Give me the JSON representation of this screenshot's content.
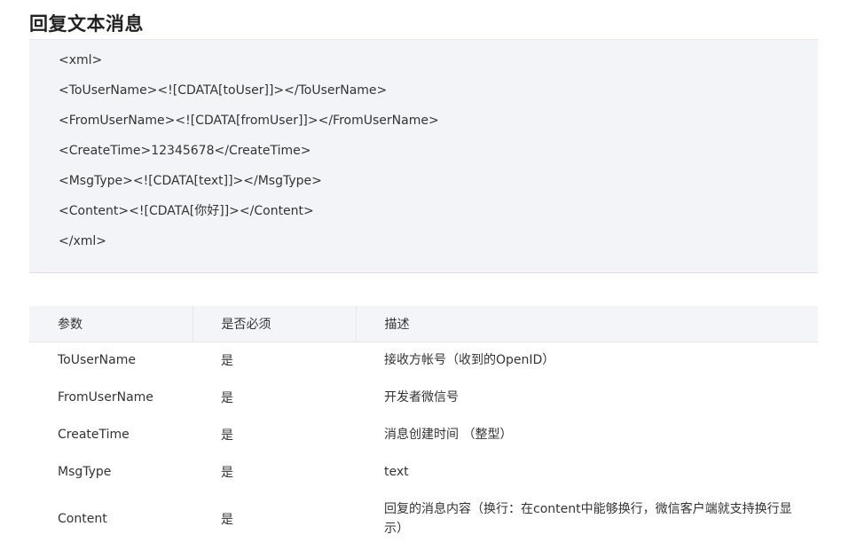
{
  "section": {
    "title": "回复文本消息"
  },
  "code": {
    "lines": [
      "<xml>",
      "<ToUserName><![CDATA[toUser]]></ToUserName>",
      "<FromUserName><![CDATA[fromUser]]></FromUserName>",
      "<CreateTime>12345678</CreateTime>",
      "<MsgType><![CDATA[text]]></MsgType>",
      "<Content><![CDATA[你好]]></Content>",
      "</xml>"
    ]
  },
  "table": {
    "headers": [
      "参数",
      "是否必须",
      "描述"
    ],
    "rows": [
      [
        "ToUserName",
        "是",
        "接收方帐号（收到的OpenID）"
      ],
      [
        "FromUserName",
        "是",
        "开发者微信号"
      ],
      [
        "CreateTime",
        "是",
        "消息创建时间 （整型）"
      ],
      [
        "MsgType",
        "是",
        "text"
      ],
      [
        "Content",
        "是",
        "回复的消息内容（换行：在content中能够换行，微信客户端就支持换行显示）"
      ]
    ]
  }
}
